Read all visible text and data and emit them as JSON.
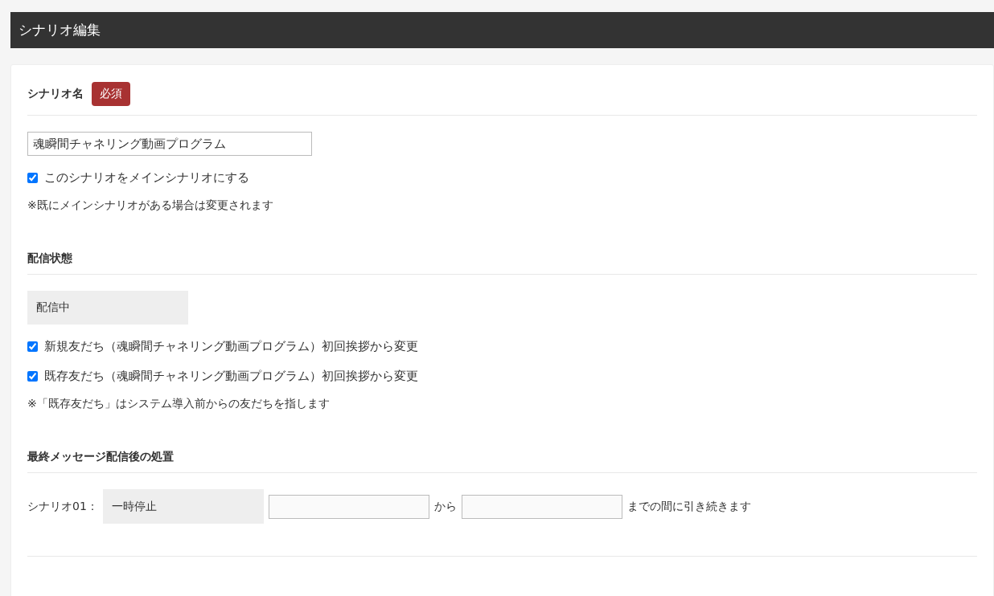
{
  "header": {
    "title": "シナリオ編集"
  },
  "sections": [
    {
      "title": "シナリオ名",
      "badge": "必須",
      "kind": "name",
      "value": "魂瞬間チャネリング動画プログラム",
      "checkboxes": [
        {
          "label": "このシナリオをメインシナリオにする",
          "checked": true
        }
      ],
      "note": "※既にメインシナリオがある場合は変更されます"
    },
    {
      "title": "配信状態",
      "kind": "status",
      "value": "配信中",
      "checkboxes": [
        {
          "label": "新規友だち（魂瞬間チャネリング動画プログラム）初回挨拶から変更",
          "checked": true
        },
        {
          "label": "既存友だち（魂瞬間チャネリング動画プログラム）初回挨拶から変更",
          "checked": true
        }
      ],
      "note": "※「既存友だち」はシステム導入前からの友だちを指します"
    },
    {
      "title": "最終メッセージ配信後の処置",
      "kind": "action",
      "row_label": "シナリオ01：",
      "value": "一時停止",
      "between": "から",
      "suffix": "までの間に引き続きます"
    }
  ]
}
